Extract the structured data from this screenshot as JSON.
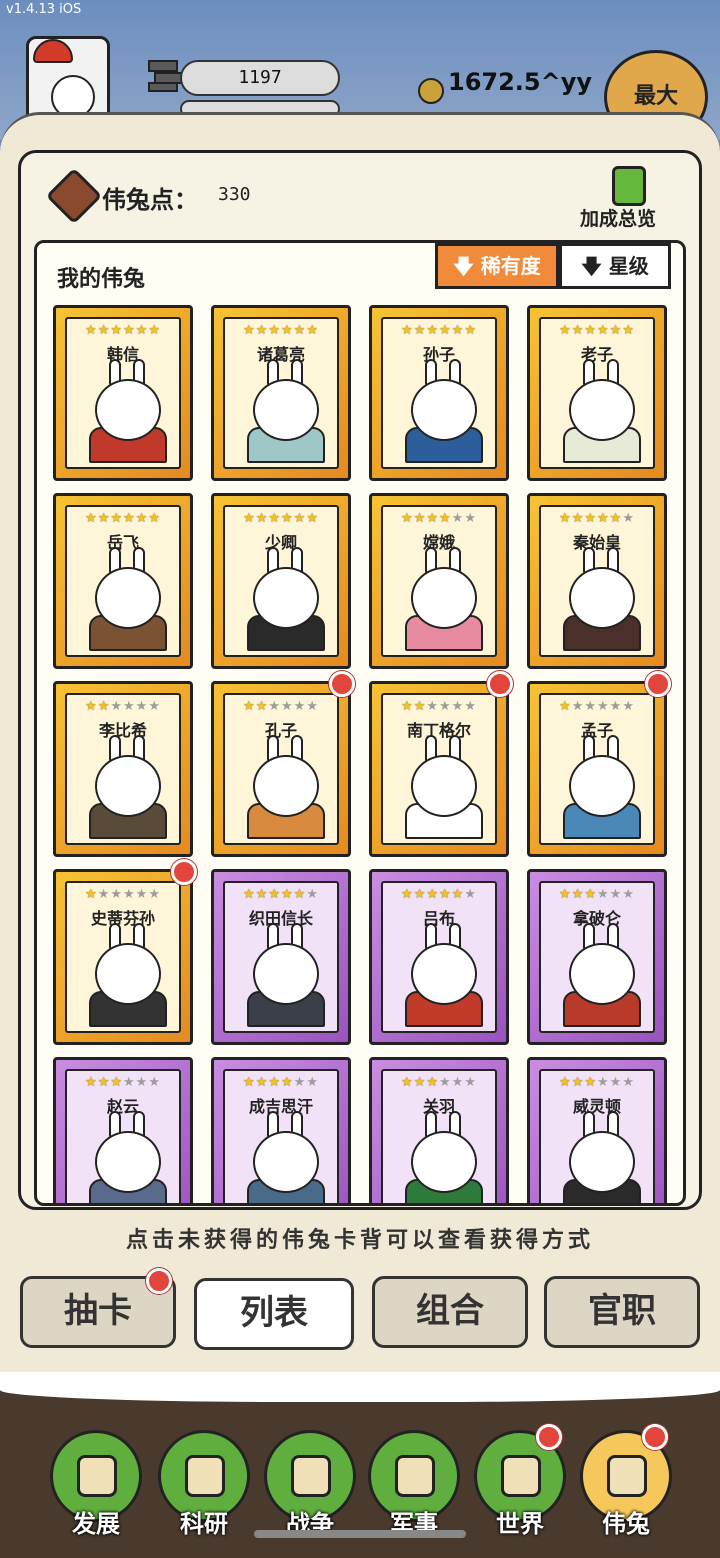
{
  "status": {
    "version": "v1.4.13 iOS"
  },
  "header": {
    "resource_value": "1197",
    "coins": "1672.5^yy",
    "max_button": "最大"
  },
  "points": {
    "label": "伟兔点：",
    "value": "330"
  },
  "bonus": {
    "label": "加成总览"
  },
  "collection": {
    "title": "我的伟兔",
    "sort_rarity": "稀有度",
    "sort_stars": "星级"
  },
  "cards": [
    {
      "name": "韩信",
      "stars": 6,
      "rarity": "gold",
      "badge": false,
      "color": "#c0392b"
    },
    {
      "name": "诸葛亮",
      "stars": 6,
      "rarity": "gold",
      "badge": false,
      "color": "#9ec7c8"
    },
    {
      "name": "孙子",
      "stars": 6,
      "rarity": "gold",
      "badge": false,
      "color": "#2d5e9c"
    },
    {
      "name": "老子",
      "stars": 6,
      "rarity": "gold",
      "badge": false,
      "color": "#e8ead8"
    },
    {
      "name": "岳飞",
      "stars": 6,
      "rarity": "gold",
      "badge": false,
      "color": "#7b5233"
    },
    {
      "name": "少卿",
      "stars": 6,
      "rarity": "gold",
      "badge": false,
      "color": "#2a2a2a"
    },
    {
      "name": "嫦娥",
      "stars": 4,
      "rarity": "gold",
      "badge": false,
      "color": "#e98ba0"
    },
    {
      "name": "秦始皇",
      "stars": 5,
      "rarity": "gold",
      "badge": false,
      "color": "#4a2f2a"
    },
    {
      "name": "李比希",
      "stars": 2,
      "rarity": "gold",
      "badge": false,
      "color": "#5a4a3a"
    },
    {
      "name": "孔子",
      "stars": 2,
      "rarity": "gold",
      "badge": true,
      "color": "#d88b3e"
    },
    {
      "name": "南丁格尔",
      "stars": 2,
      "rarity": "gold",
      "badge": true,
      "color": "#ffffff"
    },
    {
      "name": "孟子",
      "stars": 1,
      "rarity": "gold",
      "badge": true,
      "color": "#4a88b8"
    },
    {
      "name": "史蒂芬孙",
      "stars": 1,
      "rarity": "gold",
      "badge": true,
      "color": "#333333"
    },
    {
      "name": "织田信长",
      "stars": 5,
      "rarity": "purple",
      "badge": false,
      "color": "#3a3f4a"
    },
    {
      "name": "吕布",
      "stars": 5,
      "rarity": "purple",
      "badge": false,
      "color": "#c23a2a"
    },
    {
      "name": "拿破仑",
      "stars": 3,
      "rarity": "purple",
      "badge": false,
      "color": "#b83a2a"
    },
    {
      "name": "赵云",
      "stars": 3,
      "rarity": "purple",
      "badge": false,
      "color": "#5a6a8a"
    },
    {
      "name": "成吉思汗",
      "stars": 4,
      "rarity": "purple",
      "badge": false,
      "color": "#4a6a8a"
    },
    {
      "name": "关羽",
      "stars": 3,
      "rarity": "purple",
      "badge": false,
      "color": "#2e7a3a"
    },
    {
      "name": "威灵顿",
      "stars": 3,
      "rarity": "purple",
      "badge": false,
      "color": "#2a2a2a"
    }
  ],
  "hint": "点击未获得的伟兔卡背可以查看获得方式",
  "tabs": [
    {
      "label": "抽卡",
      "active": false,
      "badge": true
    },
    {
      "label": "列表",
      "active": true,
      "badge": false
    },
    {
      "label": "组合",
      "active": false,
      "badge": false
    },
    {
      "label": "官职",
      "active": false,
      "badge": false
    }
  ],
  "nav": [
    {
      "label": "发展",
      "icon": "growth-icon",
      "active": false,
      "badge": false
    },
    {
      "label": "科研",
      "icon": "flask-icon",
      "active": false,
      "badge": false
    },
    {
      "label": "战争",
      "icon": "swords-icon",
      "active": false,
      "badge": false
    },
    {
      "label": "军事",
      "icon": "tent-icon",
      "active": false,
      "badge": false
    },
    {
      "label": "世界",
      "icon": "globe-icon",
      "active": false,
      "badge": true
    },
    {
      "label": "伟兔",
      "icon": "rabbit-card-icon",
      "active": true,
      "badge": true
    }
  ]
}
